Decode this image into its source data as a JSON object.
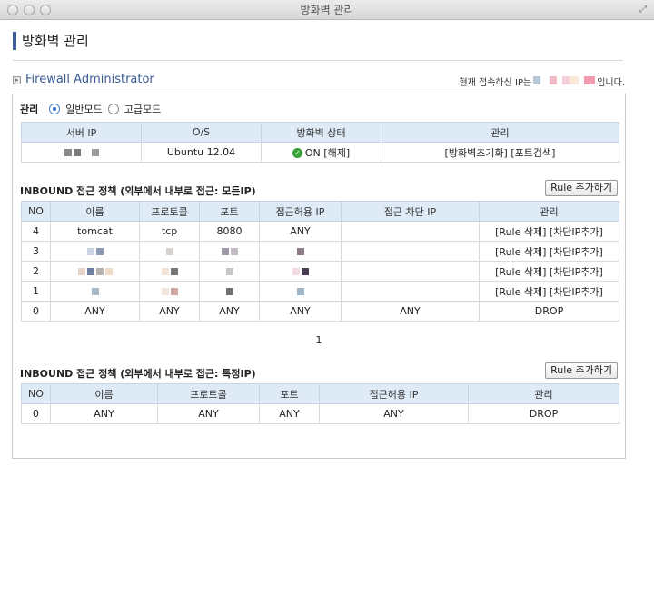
{
  "window": {
    "title": "방화벽 관리"
  },
  "page": {
    "title": "방화벽 관리"
  },
  "section": {
    "title": "Firewall Administrator",
    "ip_prefix": "현재 접속하신 IP는",
    "ip_suffix": "입니다."
  },
  "mode": {
    "label": "관리",
    "options": [
      {
        "label": "일반모드",
        "selected": true
      },
      {
        "label": "고급모드",
        "selected": false
      }
    ]
  },
  "server_table": {
    "headers": [
      "서버 IP",
      "O/S",
      "방화벽 상태",
      "관리"
    ],
    "row": {
      "os": "Ubuntu 12.04",
      "status": "ON",
      "status_action": "[해제]",
      "manage_reset": "[방화벽초기화]",
      "manage_scan": "[포트검색]"
    }
  },
  "inbound_all": {
    "title": "INBOUND 접근 정책 (외부에서 내부로 접근: 모든IP)",
    "add_button": "Rule 추가하기",
    "headers": [
      "NO",
      "이름",
      "프로토콜",
      "포트",
      "접근허용 IP",
      "접근 차단 IP",
      "관리"
    ],
    "rows": [
      {
        "no": "4",
        "name": "tomcat",
        "protocol": "tcp",
        "port": "8080",
        "allow_ip": "ANY",
        "block_ip": "",
        "manage": "[Rule 삭제] [차단IP추가]"
      },
      {
        "no": "3",
        "name": "",
        "protocol": "",
        "port": "",
        "allow_ip": "",
        "block_ip": "",
        "manage": "[Rule 삭제] [차단IP추가]"
      },
      {
        "no": "2",
        "name": "",
        "protocol": "",
        "port": "",
        "allow_ip": "",
        "block_ip": "",
        "manage": "[Rule 삭제] [차단IP추가]"
      },
      {
        "no": "1",
        "name": "",
        "protocol": "",
        "port": "",
        "allow_ip": "",
        "block_ip": "",
        "manage": "[Rule 삭제] [차단IP추가]"
      },
      {
        "no": "0",
        "name": "ANY",
        "protocol": "ANY",
        "port": "ANY",
        "allow_ip": "ANY",
        "block_ip": "ANY",
        "manage": "DROP"
      }
    ],
    "page": "1"
  },
  "inbound_specific": {
    "title": "INBOUND 접근 정책 (외부에서 내부로 접근: 특정IP)",
    "add_button": "Rule 추가하기",
    "headers": [
      "NO",
      "이름",
      "프로토콜",
      "포트",
      "접근허용 IP",
      "관리"
    ],
    "rows": [
      {
        "no": "0",
        "name": "ANY",
        "protocol": "ANY",
        "port": "ANY",
        "allow_ip": "ANY",
        "manage": "DROP"
      }
    ]
  },
  "colors": {
    "accent": "#3d5d9b",
    "header_bg": "#dfeaf7",
    "status_ok": "#3aa13a"
  }
}
